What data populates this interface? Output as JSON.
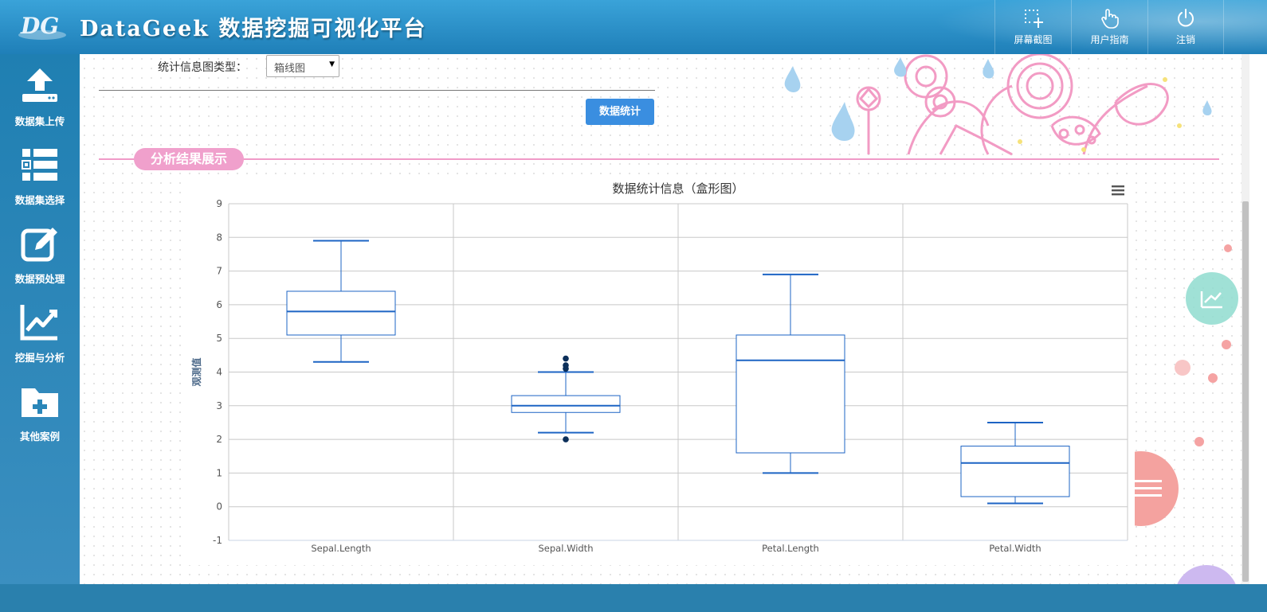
{
  "header": {
    "logo_text": "DG",
    "brand": "DataGeek 数据挖掘可视化平台",
    "buttons": [
      {
        "label": "屏幕截图",
        "icon": "screenshot-icon"
      },
      {
        "label": "用户指南",
        "icon": "hand-pointer-icon"
      },
      {
        "label": "注销",
        "icon": "power-icon"
      }
    ]
  },
  "sidebar": {
    "items": [
      {
        "label": "数据集上传",
        "icon": "upload-icon"
      },
      {
        "label": "数据集选择",
        "icon": "list-icon"
      },
      {
        "label": "数据预处理",
        "icon": "edit-icon"
      },
      {
        "label": "挖掘与分析",
        "icon": "line-chart-icon"
      },
      {
        "label": "其他案例",
        "icon": "folder-plus-icon"
      }
    ]
  },
  "form": {
    "type_label": "统计信息图类型：",
    "type_value": "箱线图",
    "stat_button": "数据统计"
  },
  "section": {
    "title": "分析结果展示"
  },
  "colors": {
    "accent": "#3a8ee0",
    "pink": "#f0a0cc",
    "box_stroke": "#1d64c4",
    "sidebar": "#1f7fb2"
  },
  "chart_data": {
    "type": "boxplot",
    "title": "数据统计信息（盒形图）",
    "ylabel": "观测值",
    "ylim": [
      -1,
      9
    ],
    "yticks": [
      "-1",
      "0",
      "1",
      "2",
      "3",
      "4",
      "5",
      "6",
      "7",
      "8",
      "9"
    ],
    "categories": [
      "Sepal.Length",
      "Sepal.Width",
      "Petal.Length",
      "Petal.Width"
    ],
    "boxes": [
      {
        "min": 4.3,
        "q1": 5.1,
        "median": 5.8,
        "q3": 6.4,
        "max": 7.9
      },
      {
        "min": 2.2,
        "q1": 2.8,
        "median": 3.0,
        "q3": 3.3,
        "max": 4.0
      },
      {
        "min": 1.0,
        "q1": 1.6,
        "median": 4.35,
        "q3": 5.1,
        "max": 6.9
      },
      {
        "min": 0.1,
        "q1": 0.3,
        "median": 1.3,
        "q3": 1.8,
        "max": 2.5
      }
    ],
    "outliers": [
      {
        "category": "Sepal.Width",
        "values": [
          4.4,
          4.2,
          4.1,
          2.0
        ]
      }
    ],
    "grid": true
  }
}
